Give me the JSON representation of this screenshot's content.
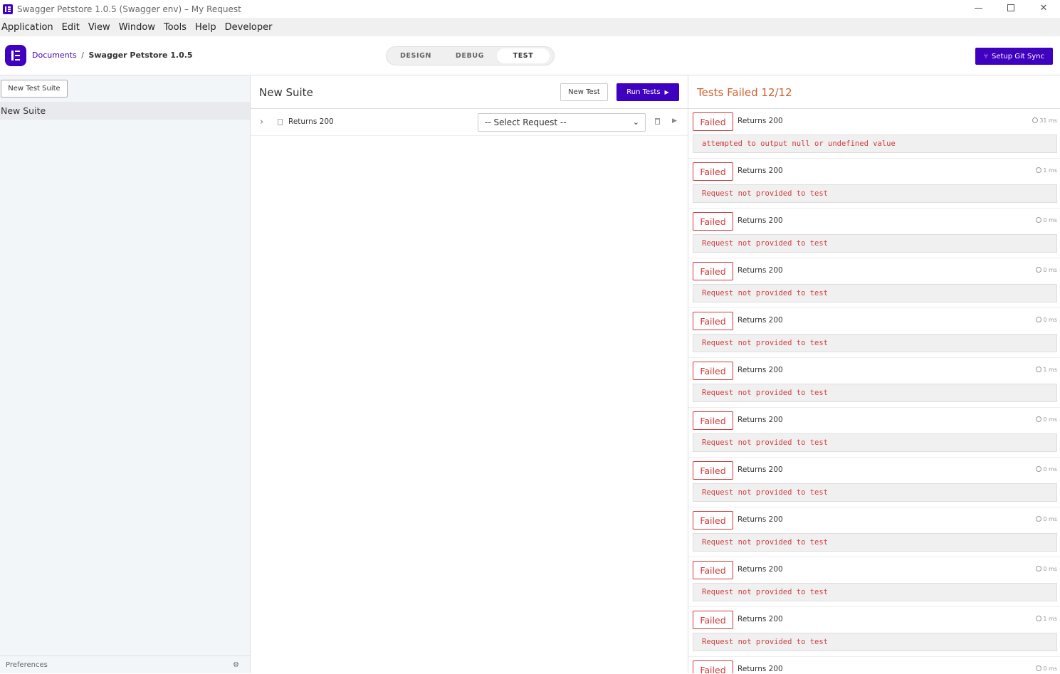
{
  "window": {
    "title": "Swagger Petstore 1.0.5 (Swagger env) – My Request"
  },
  "menu": [
    "Application",
    "Edit",
    "View",
    "Window",
    "Tools",
    "Help",
    "Developer"
  ],
  "header": {
    "breadcrumb_link": "Documents",
    "breadcrumb_sep": "/",
    "breadcrumb_current": "Swagger Petstore 1.0.5",
    "tabs": [
      "DESIGN",
      "DEBUG",
      "TEST"
    ],
    "active_tab": "TEST",
    "git_button": "Setup Git Sync"
  },
  "sidebar": {
    "new_suite_button": "New Test Suite",
    "suites": [
      "New Suite"
    ],
    "preferences": "Preferences"
  },
  "suite": {
    "title": "New Suite",
    "new_test_button": "New Test",
    "run_tests_button": "Run Tests",
    "tests": [
      {
        "name": "Returns 200",
        "request_select": "-- Select Request --"
      }
    ]
  },
  "results": {
    "title": "Tests Failed 12/12",
    "items": [
      {
        "status": "Failed",
        "name": "Returns 200",
        "time": "31 ms",
        "error": "attempted to output null or undefined value"
      },
      {
        "status": "Failed",
        "name": "Returns 200",
        "time": "1 ms",
        "error": "Request not provided to test"
      },
      {
        "status": "Failed",
        "name": "Returns 200",
        "time": "0 ms",
        "error": "Request not provided to test"
      },
      {
        "status": "Failed",
        "name": "Returns 200",
        "time": "0 ms",
        "error": "Request not provided to test"
      },
      {
        "status": "Failed",
        "name": "Returns 200",
        "time": "0 ms",
        "error": "Request not provided to test"
      },
      {
        "status": "Failed",
        "name": "Returns 200",
        "time": "1 ms",
        "error": "Request not provided to test"
      },
      {
        "status": "Failed",
        "name": "Returns 200",
        "time": "0 ms",
        "error": "Request not provided to test"
      },
      {
        "status": "Failed",
        "name": "Returns 200",
        "time": "0 ms",
        "error": "Request not provided to test"
      },
      {
        "status": "Failed",
        "name": "Returns 200",
        "time": "0 ms",
        "error": "Request not provided to test"
      },
      {
        "status": "Failed",
        "name": "Returns 200",
        "time": "0 ms",
        "error": "Request not provided to test"
      },
      {
        "status": "Failed",
        "name": "Returns 200",
        "time": "1 ms",
        "error": "Request not provided to test"
      },
      {
        "status": "Failed",
        "name": "Returns 200",
        "time": "0 ms",
        "error": ""
      }
    ]
  },
  "colors": {
    "brand": "#4000bf",
    "failed": "#cf3a3a",
    "failed_title": "#d06030"
  }
}
